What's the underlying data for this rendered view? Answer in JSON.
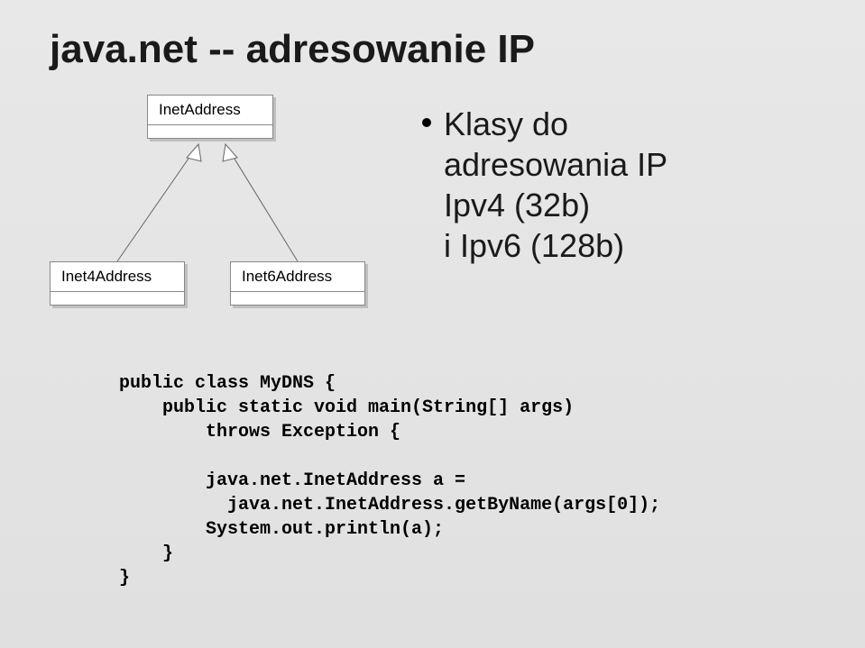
{
  "title": "java.net -- adresowanie IP",
  "bullets": {
    "l1": "Klasy do",
    "l2": "adresowania IP",
    "l3": "Ipv4 (32b)",
    "l4": "i Ipv6 (128b)"
  },
  "uml": {
    "parent": "InetAddress",
    "child1": "Inet4Address",
    "child2": "Inet6Address"
  },
  "code": {
    "l1": "public class MyDNS {",
    "l2": "    public static void main(String[] args)",
    "l3": "        throws Exception {",
    "l4": "",
    "l5": "        java.net.InetAddress a =",
    "l6": "          java.net.InetAddress.getByName(args[0]);",
    "l7": "        System.out.println(a);",
    "l8": "    }",
    "l9": "}"
  }
}
